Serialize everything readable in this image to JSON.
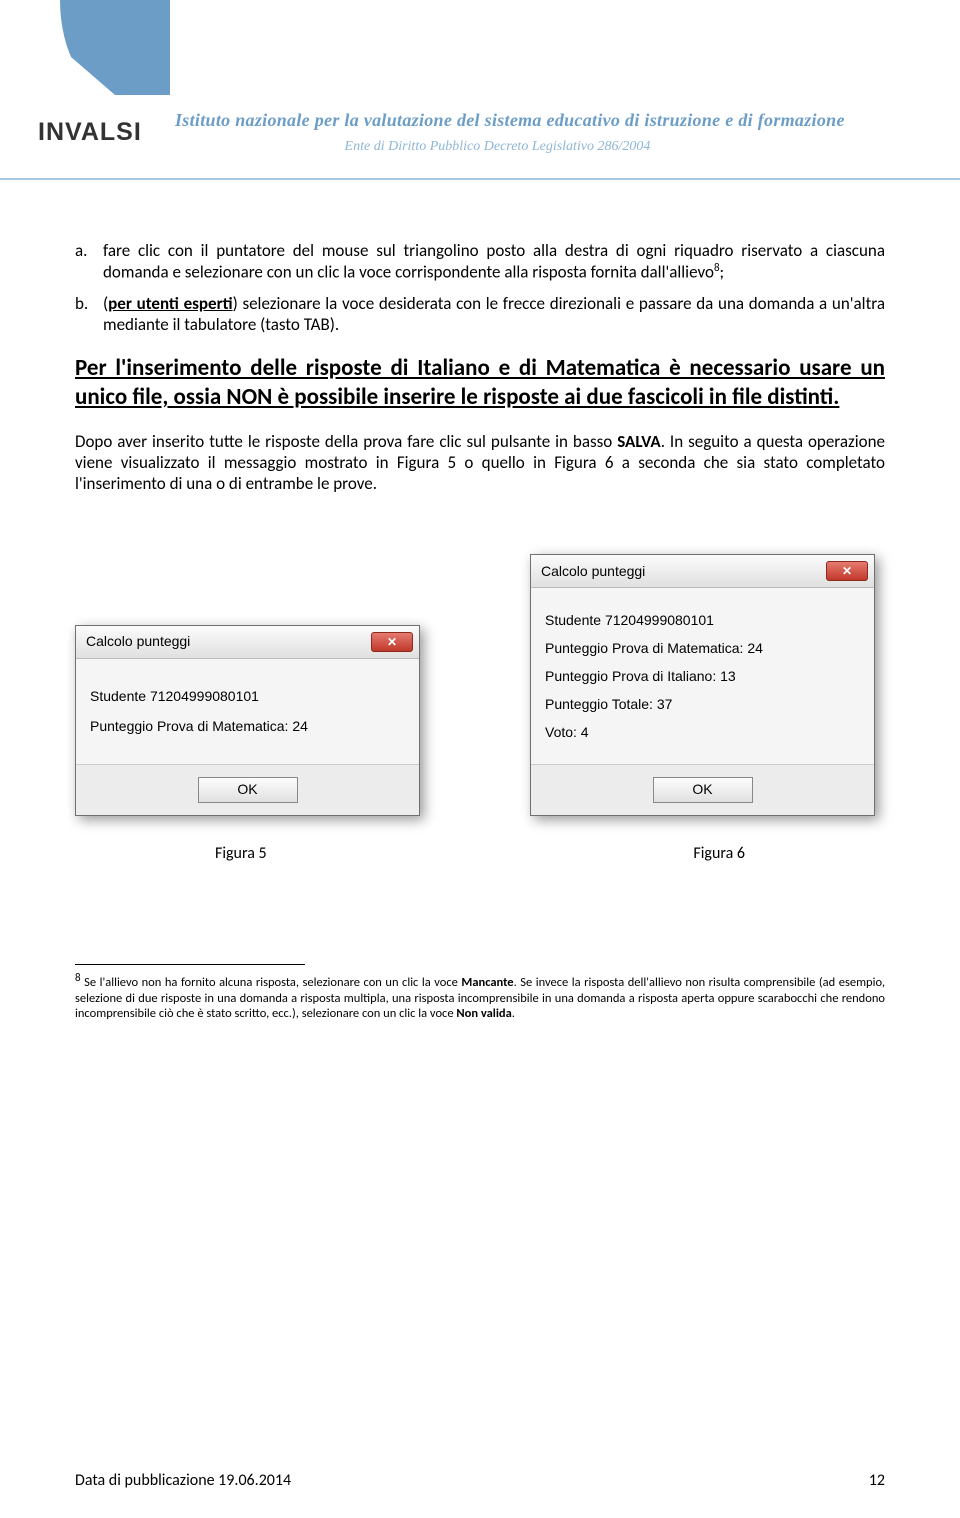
{
  "header": {
    "logo_text": "INVALSI",
    "title_main": "Istituto nazionale per la valutazione del sistema educativo di istruzione e di formazione",
    "title_sub": "Ente di Diritto Pubblico Decreto Legislativo 286/2004"
  },
  "list": {
    "item_a_marker": "a.",
    "item_a_text": "fare clic con il puntatore del mouse sul triangolino posto alla destra di ogni riquadro riservato a ciascuna domanda e selezionare con un clic la voce corrispondente alla risposta fornita dall'allievo",
    "item_a_sup": "8",
    "item_a_end": ";",
    "item_b_marker": "b.",
    "item_b_prefix": "(",
    "item_b_bold": "per utenti esperti",
    "item_b_text": ") selezionare la voce desiderata con le frecce direzionali e passare da una domanda a un'altra mediante il tabulatore (tasto TAB)."
  },
  "heading_underline": "Per l'inserimento delle risposte di Italiano e di Matematica è necessario usare un unico file, ossia NON è possibile inserire le risposte ai due fascicoli in file distinti.",
  "para1_a": "Dopo aver inserito tutte le risposte della prova fare clic sul pulsante in basso ",
  "para1_bold": "SALVA",
  "para1_b": ". In seguito a questa operazione viene visualizzato il messaggio mostrato in Figura 5 o quello in Figura 6 a seconda che sia stato completato l'inserimento di una o di entrambe le prove.",
  "dialog1": {
    "title": "Calcolo punteggi",
    "line1": "Studente 71204999080101",
    "line2": "Punteggio Prova di Matematica: 24",
    "ok": "OK"
  },
  "dialog2": {
    "title": "Calcolo punteggi",
    "line1": "Studente 71204999080101",
    "line2": "Punteggio Prova di Matematica: 24",
    "line3": "Punteggio Prova di Italiano: 13",
    "line4": "Punteggio Totale: 37",
    "line5": "Voto: 4",
    "ok": "OK"
  },
  "captions": {
    "left": "Figura 5",
    "right": "Figura 6"
  },
  "footnote": {
    "sup": "8",
    "text_a": " Se l'allievo non ha fornito alcuna risposta, selezionare con un clic la voce ",
    "bold1": "Mancante",
    "text_b": ". Se invece la risposta dell'allievo non risulta comprensibile (ad esempio, selezione di due risposte in una domanda a risposta multipla, una risposta incomprensibile in una domanda a risposta aperta oppure scarabocchi che rendono incomprensibile ciò che è stato scritto, ecc.), selezionare con un clic la voce ",
    "bold2": "Non valida",
    "text_c": "."
  },
  "footer": {
    "left": "Data di pubblicazione 19.06.2014",
    "right": "12"
  }
}
